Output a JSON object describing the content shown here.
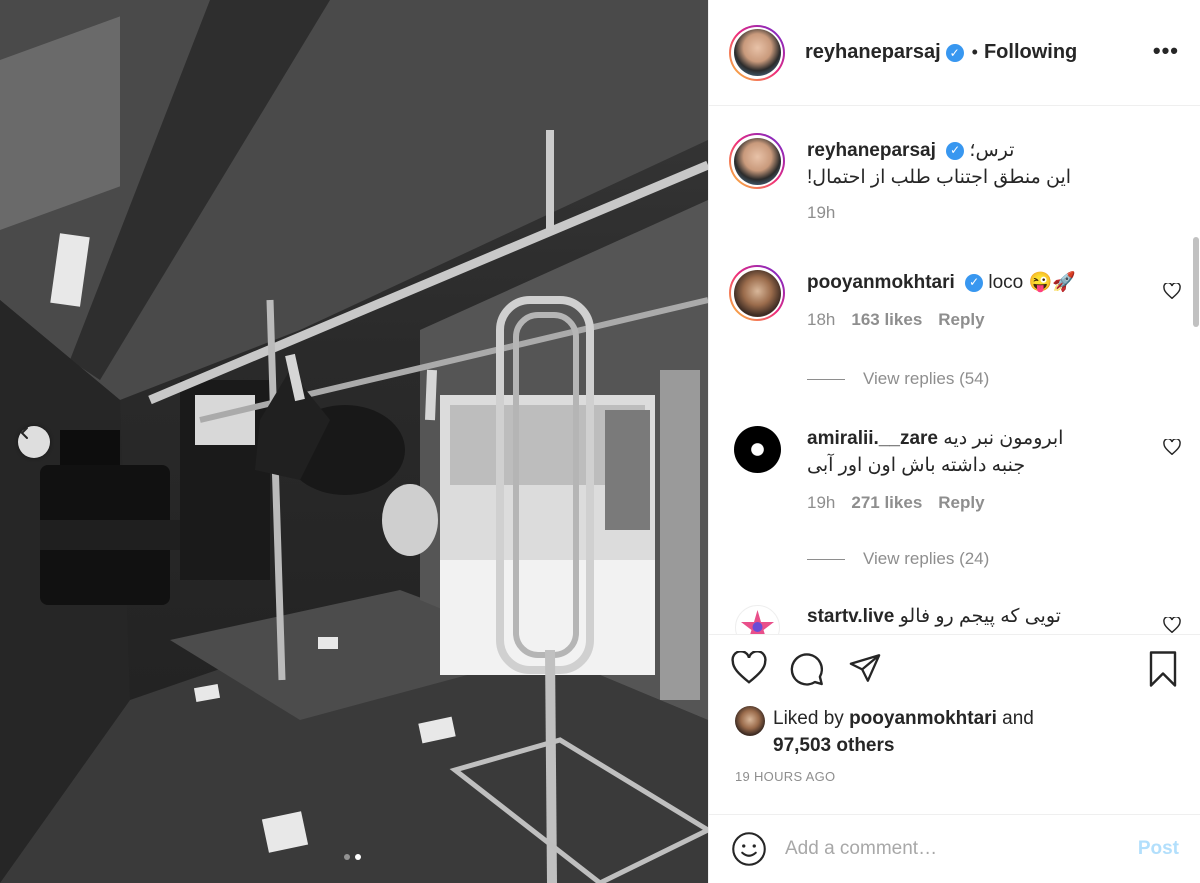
{
  "post": {
    "username": "reyhaneparsaj",
    "separator": "•",
    "follow_status": "Following",
    "more_icon": "more-horizontal-icon",
    "carousel_current": 2,
    "carousel_total": 2
  },
  "caption": {
    "username": "reyhaneparsaj",
    "line1": "ترس؛",
    "line2": "!این منطق اجتناب طلب از احتمال",
    "time": "19h"
  },
  "comments": [
    {
      "username": "pooyanmokhtari",
      "verified": true,
      "text": "loco 😜🚀",
      "time": "18h",
      "likes": "163 likes",
      "reply": "Reply",
      "view_replies": "View replies (54)"
    },
    {
      "username": "amiralii.__zare",
      "verified": false,
      "text": "ابرومون نبر دیه",
      "text2": "جنبه داشته باش اون اور آبی",
      "time": "19h",
      "likes": "271 likes",
      "reply": "Reply",
      "view_replies": "View replies (24)"
    },
    {
      "username": "startv.live",
      "verified": false,
      "text": "تویی که پیجم رو فالو"
    }
  ],
  "actions": {
    "like_icon": "heart-icon",
    "comment_icon": "comment-icon",
    "share_icon": "send-icon",
    "save_icon": "bookmark-icon"
  },
  "likes": {
    "prefix": "Liked by",
    "user": "pooyanmokhtari",
    "and": "and",
    "others": "97,503 others"
  },
  "time_ago": "19 HOURS AGO",
  "add_comment": {
    "placeholder": "Add a comment…",
    "post_label": "Post"
  },
  "colors": {
    "verified": "#3897f0",
    "post_disabled": "#b2dffc",
    "secondary_text": "#8e8e8e"
  }
}
